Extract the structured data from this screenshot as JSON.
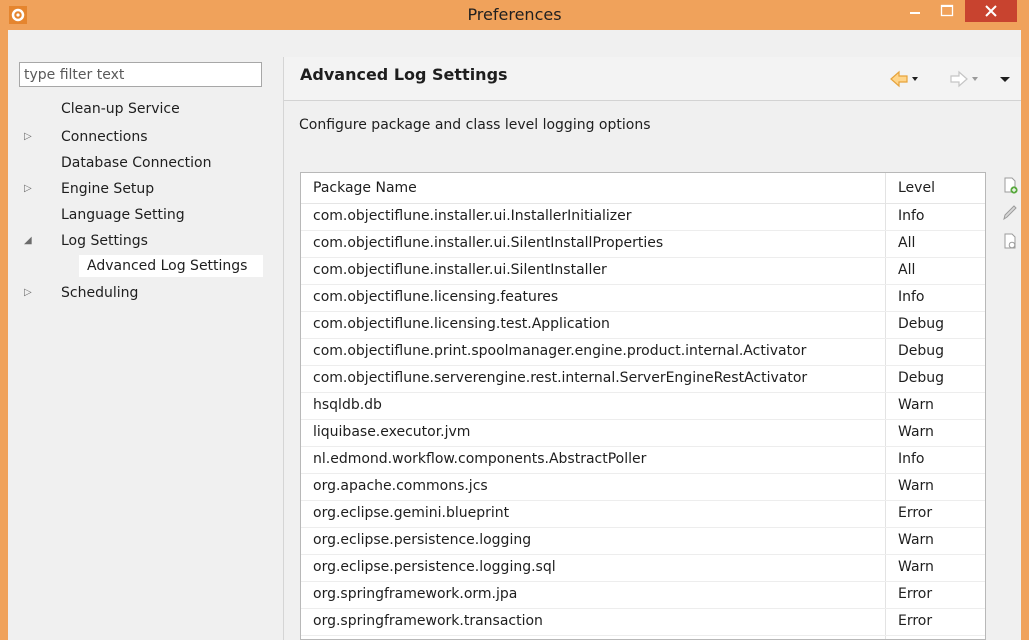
{
  "window": {
    "title": "Preferences"
  },
  "filter": {
    "placeholder": "type filter text"
  },
  "tree": [
    {
      "label": "Clean-up Service",
      "expander": ""
    },
    {
      "label": "Connections",
      "expander": "collapsed"
    },
    {
      "label": "Database Connection",
      "expander": ""
    },
    {
      "label": "Engine Setup",
      "expander": "collapsed"
    },
    {
      "label": "Language Setting",
      "expander": ""
    },
    {
      "label": "Log Settings",
      "expander": "expanded"
    },
    {
      "label": "Advanced Log Settings",
      "expander": "",
      "child": true,
      "selected": true
    },
    {
      "label": "Scheduling",
      "expander": "collapsed"
    }
  ],
  "page": {
    "title": "Advanced Log Settings",
    "description": "Configure package and class level logging options"
  },
  "table": {
    "columns": [
      "Package Name",
      "Level"
    ],
    "rows": [
      [
        "com.objectiflune.installer.ui.InstallerInitializer",
        "Info"
      ],
      [
        "com.objectiflune.installer.ui.SilentInstallProperties",
        "All"
      ],
      [
        "com.objectiflune.installer.ui.SilentInstaller",
        "All"
      ],
      [
        "com.objectiflune.licensing.features",
        "Info"
      ],
      [
        "com.objectiflune.licensing.test.Application",
        "Debug"
      ],
      [
        "com.objectiflune.print.spoolmanager.engine.product.internal.Activator",
        "Debug"
      ],
      [
        "com.objectiflune.serverengine.rest.internal.ServerEngineRestActivator",
        "Debug"
      ],
      [
        "hsqldb.db",
        "Warn"
      ],
      [
        "liquibase.executor.jvm",
        "Warn"
      ],
      [
        "nl.edmond.workflow.components.AbstractPoller",
        "Info"
      ],
      [
        "org.apache.commons.jcs",
        "Warn"
      ],
      [
        "org.eclipse.gemini.blueprint",
        "Error"
      ],
      [
        "org.eclipse.persistence.logging",
        "Warn"
      ],
      [
        "org.eclipse.persistence.logging.sql",
        "Warn"
      ],
      [
        "org.springframework.orm.jpa",
        "Error"
      ],
      [
        "org.springframework.transaction",
        "Error"
      ]
    ]
  },
  "colors": {
    "titlebar": "#f0a25b",
    "close": "#c8432f",
    "nav_arrow": "#e6a33b"
  },
  "icons": {
    "app": "gear-icon",
    "minimize": "minimize-icon",
    "maximize": "maximize-icon",
    "close": "close-icon",
    "back": "back-arrow-icon",
    "forward": "forward-arrow-icon",
    "add": "add-entry-icon",
    "edit": "edit-pencil-icon",
    "remove": "remove-entry-icon"
  }
}
